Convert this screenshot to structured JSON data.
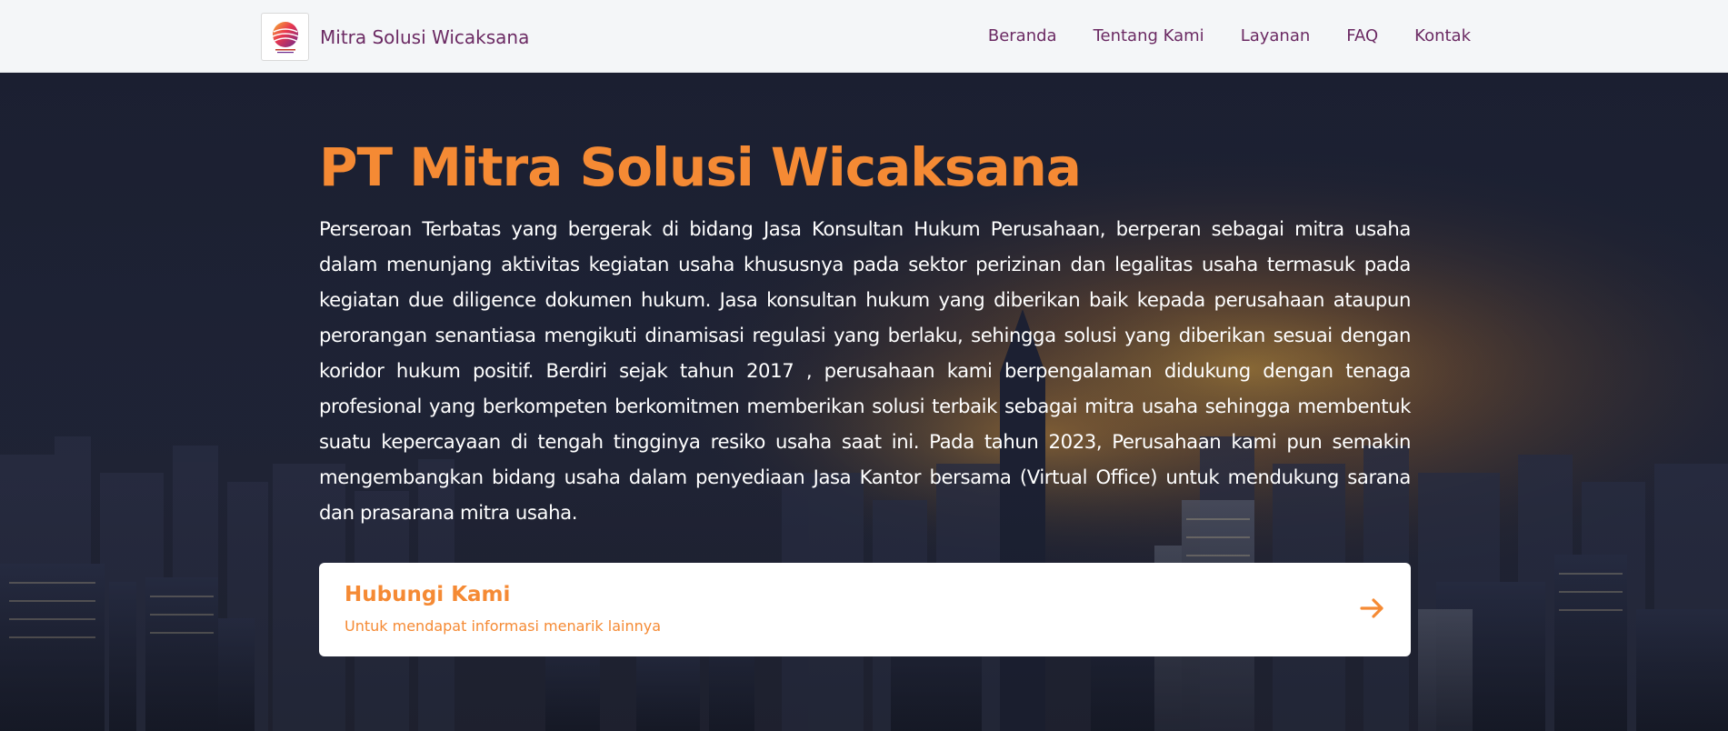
{
  "header": {
    "brand_name": "Mitra Solusi Wicaksana",
    "logo_icon": "company-logo-globe",
    "nav": [
      {
        "label": "Beranda"
      },
      {
        "label": "Tentang Kami"
      },
      {
        "label": "Layanan"
      },
      {
        "label": "FAQ"
      },
      {
        "label": "Kontak"
      }
    ]
  },
  "hero": {
    "title": "PT Mitra Solusi Wicaksana",
    "description": "Perseroan Terbatas yang bergerak di bidang Jasa Konsultan Hukum Perusahaan, berperan sebagai mitra usaha dalam menunjang aktivitas kegiatan usaha khususnya pada sektor perizinan dan legalitas usaha termasuk pada kegiatan due diligence dokumen hukum. Jasa konsultan hukum yang diberikan baik kepada perusahaan ataupun perorangan senantiasa mengikuti dinamisasi regulasi yang berlaku, sehingga solusi yang diberikan sesuai dengan koridor hukum positif. Berdiri sejak tahun 2017 , perusahaan kami berpengalaman didukung dengan tenaga profesional yang berkompeten berkomitmen memberikan solusi terbaik sebagai mitra usaha sehingga membentuk suatu kepercayaan di tengah tingginya resiko usaha saat ini. Pada tahun 2023, Perusahaan kami pun semakin mengembangkan bidang usaha dalam penyediaan Jasa Kantor bersama (Virtual Office) untuk mendukung sarana dan prasarana mitra usaha.",
    "background": "city-skyline-at-dusk"
  },
  "cta": {
    "title": "Hubungi Kami",
    "subtitle": "Untuk mendapat informasi menarik lainnya",
    "icon": "arrow-right-icon"
  },
  "colors": {
    "accent": "#f58a34",
    "brand": "#6b2a63",
    "nav_bg": "#f4f6f8"
  }
}
